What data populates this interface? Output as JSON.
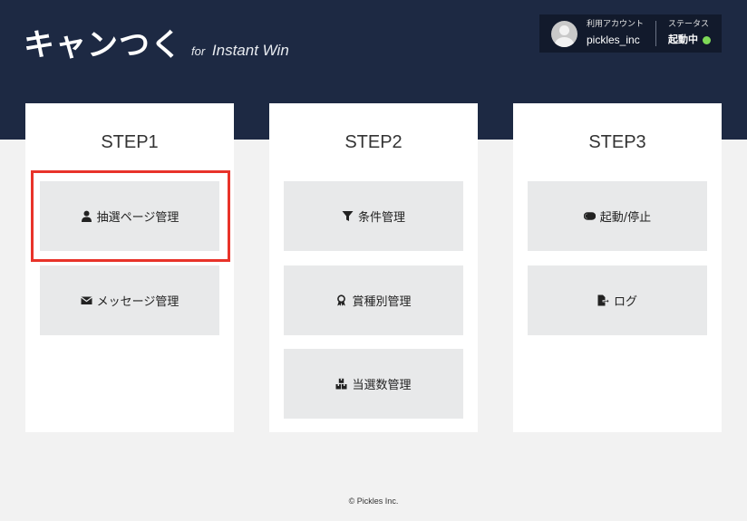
{
  "header": {
    "logo_main": "キャンつく",
    "logo_for": "for",
    "logo_sub": "Instant Win",
    "account_label": "利用アカウント",
    "account_name": "pickles_inc",
    "status_label": "ステータス",
    "status_value": "起動中",
    "status_color": "#7ed957",
    "background_color": "#1d2943"
  },
  "steps": [
    {
      "title": "STEP1",
      "buttons": [
        {
          "label": "抽選ページ管理",
          "icon": "user-icon"
        },
        {
          "label": "メッセージ管理",
          "icon": "envelope-icon"
        }
      ]
    },
    {
      "title": "STEP2",
      "buttons": [
        {
          "label": "条件管理",
          "icon": "filter-icon"
        },
        {
          "label": "賞種別管理",
          "icon": "award-icon"
        },
        {
          "label": "当選数管理",
          "icon": "boxes-icon"
        }
      ]
    },
    {
      "title": "STEP3",
      "buttons": [
        {
          "label": "起動/停止",
          "icon": "toggle-icon"
        },
        {
          "label": "ログ",
          "icon": "export-icon"
        }
      ]
    }
  ],
  "highlight_color": "#e8332a",
  "footer": {
    "copyright": "© Pickles Inc."
  }
}
